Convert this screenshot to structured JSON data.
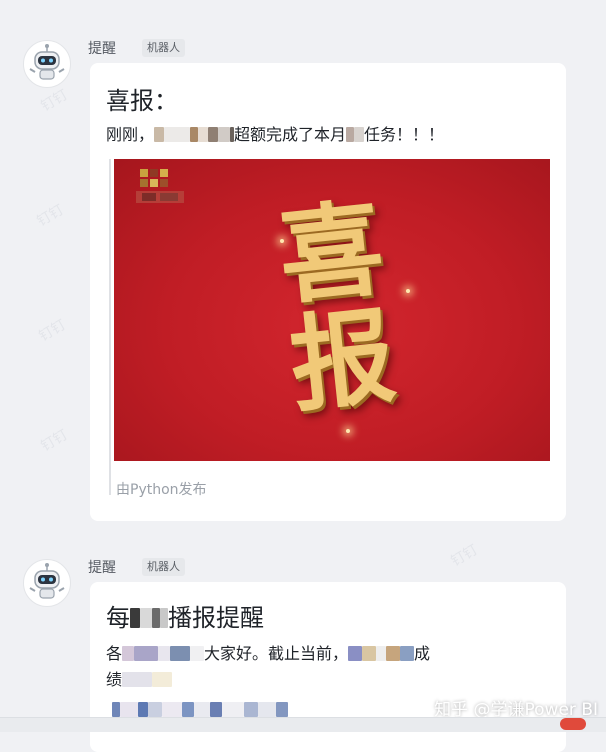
{
  "colors": {
    "background": "#f0f1f4",
    "bubble": "#ffffff",
    "poster_red": "#c01d25",
    "poster_gold": "#f1c978"
  },
  "messages": [
    {
      "sender": "提醒",
      "tag": "机器人",
      "title": "喜报：",
      "line1_prefix": "刚刚，",
      "line1_mid": "超额完成了本月",
      "line1_suffix": "任务！！！",
      "poster_text": "喜报",
      "footer": "由Python发布"
    },
    {
      "sender": "提醒",
      "tag": "机器人",
      "title_prefix": "每",
      "title_suffix": "播报提醒",
      "line1_prefix": "各",
      "line1_mid": "大家好。截止当前，",
      "line1_suffix": "成",
      "line2_prefix": "绩"
    }
  ],
  "watermark": "知乎 @学谦Power BI"
}
